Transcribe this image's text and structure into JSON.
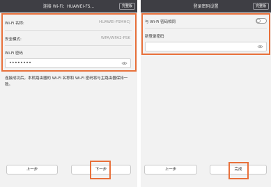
{
  "left": {
    "title": "连接 Wi-Fi：HUAWEI-FS...",
    "advanced_label": "完整版",
    "wifi_name_label": "Wi-Fi 名称:",
    "wifi_name_value": "HUAWEI-FSMHCJ",
    "security_label": "安全模式:",
    "security_value": "WPA/WPA2-PSK",
    "password_label": "Wi-Fi 密码",
    "password_value": "••••••••",
    "note": "连接成功后，本机路由器的 Wi-Fi 名称和 Wi-Fi 密码将与主路由器保持一致。",
    "prev_button": "上一步",
    "next_button": "下一步"
  },
  "right": {
    "title": "登录密码设置",
    "advanced_label": "完整版",
    "same_as_wifi_label": "与 Wi-Fi 密码相同",
    "same_as_wifi_on": false,
    "new_password_label": "新登录密码",
    "new_password_value": "",
    "prev_button": "上一步",
    "done_button": "完成"
  },
  "colors": {
    "titlebar": "#3e3e44",
    "highlight": "#e8703a",
    "background": "#f2f2f2"
  }
}
